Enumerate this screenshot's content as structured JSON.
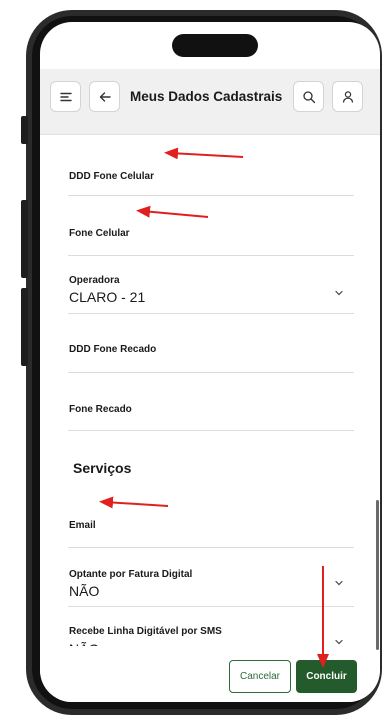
{
  "header": {
    "title": "Meus Dados Cadastrais",
    "menu_icon": "menu-icon",
    "back_icon": "arrow-left-icon",
    "search_icon": "search-icon",
    "user_icon": "user-icon"
  },
  "fields": [
    {
      "label": "DDD Fone Celular",
      "value": ""
    },
    {
      "label": "Fone Celular",
      "value": ""
    },
    {
      "label": "Operadora",
      "value": "CLARO - 21"
    },
    {
      "label": "DDD Fone Recado",
      "value": ""
    },
    {
      "label": "Fone Recado",
      "value": ""
    }
  ],
  "section": {
    "title": "Serviços"
  },
  "services": [
    {
      "label": "Email",
      "value": ""
    },
    {
      "label": "Optante por Fatura Digital",
      "value": "NÃO"
    },
    {
      "label": "Recebe Linha Digitável por SMS",
      "value": "NÃO"
    }
  ],
  "actions": {
    "cancel": "Cancelar",
    "confirm": "Concluir"
  },
  "colors": {
    "primary": "#245b2c",
    "annotation": "#e0201e"
  }
}
